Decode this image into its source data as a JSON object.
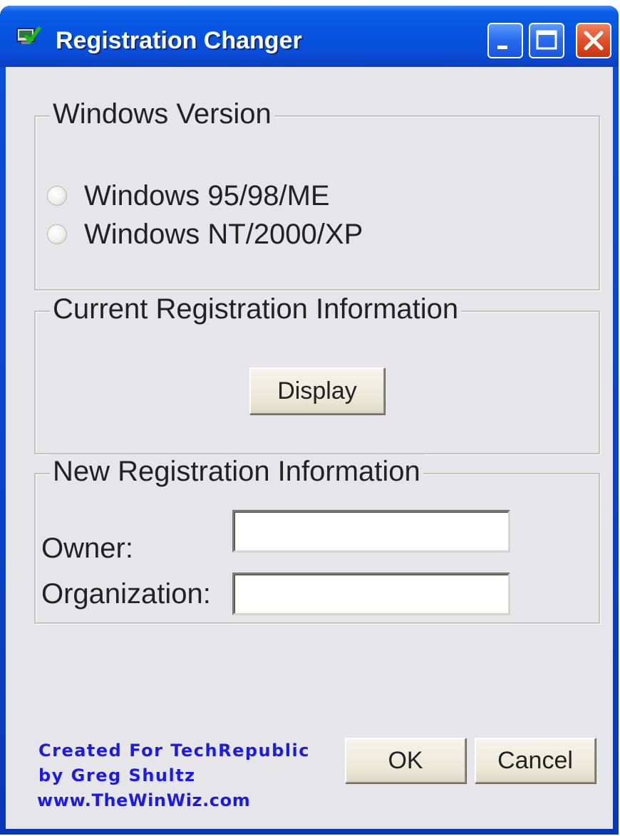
{
  "window": {
    "title": "Registration Changer",
    "buttons": {
      "minimize": "minimize-icon",
      "maximize": "maximize-icon",
      "close": "close-icon"
    }
  },
  "windows_version": {
    "label": "Windows Version",
    "options": [
      {
        "label": "Windows 95/98/ME",
        "selected": false
      },
      {
        "label": "Windows NT/2000/XP",
        "selected": false
      }
    ]
  },
  "current_registration": {
    "label": "Current Registration Information",
    "display_button": "Display"
  },
  "new_registration": {
    "label": "New Registration Information",
    "owner_label": "Owner:",
    "owner_value": "",
    "organization_label": "Organization:",
    "organization_value": ""
  },
  "credits": {
    "line1": "Created For TechRepublic",
    "line2": "by Greg Shultz",
    "line3": "www.TheWinWiz.com"
  },
  "actions": {
    "ok": "OK",
    "cancel": "Cancel"
  },
  "colors": {
    "titlebar": "#0553e0",
    "client": "#e6e5ea",
    "credit_text": "#1a1aef",
    "close_button": "#e2502a"
  }
}
